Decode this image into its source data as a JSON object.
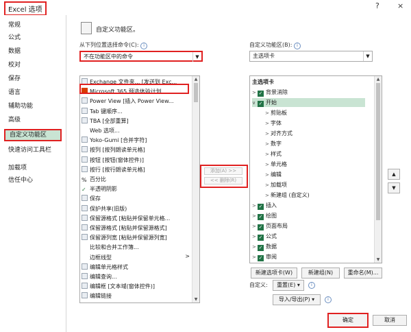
{
  "window": {
    "title": "Excel 选项",
    "help": "?",
    "close": "×"
  },
  "sidebar": {
    "items": [
      {
        "label": "常规"
      },
      {
        "label": "公式"
      },
      {
        "label": "数据"
      },
      {
        "label": "校对"
      },
      {
        "label": "保存"
      },
      {
        "label": "语言"
      },
      {
        "label": "辅助功能"
      },
      {
        "label": "高级"
      },
      {
        "label": "自定义功能区",
        "active": true
      },
      {
        "label": "快速访问工具栏"
      },
      {
        "label": "加载项"
      },
      {
        "label": "信任中心"
      }
    ]
  },
  "main": {
    "section_title": "自定义功能区。",
    "left": {
      "label": "从下列位置选择命令(C):",
      "info": "i",
      "dropdown_value": "不在功能区中的命令",
      "commands": [
        {
          "label": "Exchange 文件夹... [发送到 Exc...",
          "icon": "exchange-icon"
        },
        {
          "label": "Microsoft 365 预选体验计划",
          "icon": "office-icon",
          "highlight": true
        },
        {
          "label": "Power View [插入 Power View...",
          "icon": "powerview-icon"
        },
        {
          "label": "Tab 键顺序...",
          "icon": "tab-order-icon"
        },
        {
          "label": "TBA [全部重算]",
          "icon": "calc-icon"
        },
        {
          "label": "Web 选项...",
          "icon": "none"
        },
        {
          "label": "Yoko-Gumi [合并字符]",
          "icon": "dot-icon"
        },
        {
          "label": "按列 [按列朗读单元格]",
          "icon": "column-icon"
        },
        {
          "label": "按钮 [按钮(窗体控件)]",
          "icon": "button-icon"
        },
        {
          "label": "按行 [按行朗读单元格]",
          "icon": "row-icon"
        },
        {
          "label": "百分比",
          "icon": "percent-icon"
        },
        {
          "label": "半透明阴影",
          "icon": "check-icon"
        },
        {
          "label": "保存",
          "icon": "save-icon"
        },
        {
          "label": "保护共享(旧版)",
          "icon": "protect-icon"
        },
        {
          "label": "保留源格式 [粘贴并保留单元格...",
          "icon": "paste-icon"
        },
        {
          "label": "保留源格式 [粘贴并保留源格式]",
          "icon": "paste-icon"
        },
        {
          "label": "保留源列宽 [粘贴并保留源列宽]",
          "icon": "paste-icon"
        },
        {
          "label": "比较和合并工作簿...",
          "icon": "none"
        },
        {
          "label": "边框线型",
          "icon": "none",
          "submenu": true
        },
        {
          "label": "编辑单元格样式",
          "icon": "style-icon"
        },
        {
          "label": "编辑查询...",
          "icon": "query-icon"
        },
        {
          "label": "编辑框 [文本域(窗体控件)]",
          "icon": "textbox-icon"
        },
        {
          "label": "编辑链接",
          "icon": "link-icon"
        }
      ]
    },
    "middle": {
      "add": "添加(A) >>",
      "remove": "<< 删除(R)"
    },
    "right": {
      "label": "自定义功能区(B):",
      "info": "i",
      "dropdown_value": "主选项卡",
      "tree": [
        {
          "label": "主选项卡",
          "level": 0,
          "header": true
        },
        {
          "label": "背景消除",
          "level": 1,
          "expander": ">",
          "checked": true
        },
        {
          "label": "开始",
          "level": 1,
          "expander": "∨",
          "checked": true,
          "selected": true
        },
        {
          "label": "剪贴板",
          "level": 2,
          "expander": ">"
        },
        {
          "label": "字体",
          "level": 2,
          "expander": ">"
        },
        {
          "label": "对齐方式",
          "level": 2,
          "expander": ">"
        },
        {
          "label": "数字",
          "level": 2,
          "expander": ">"
        },
        {
          "label": "样式",
          "level": 2,
          "expander": ">"
        },
        {
          "label": "单元格",
          "level": 2,
          "expander": ">"
        },
        {
          "label": "编辑",
          "level": 2,
          "expander": ">"
        },
        {
          "label": "加载项",
          "level": 2,
          "expander": ">"
        },
        {
          "label": "新建组 (自定义)",
          "level": 2,
          "expander": ">"
        },
        {
          "label": "插入",
          "level": 1,
          "expander": ">",
          "checked": true
        },
        {
          "label": "绘图",
          "level": 1,
          "expander": ">",
          "checked": true
        },
        {
          "label": "页面布局",
          "level": 1,
          "expander": ">",
          "checked": true
        },
        {
          "label": "公式",
          "level": 1,
          "expander": ">",
          "checked": true
        },
        {
          "label": "数据",
          "level": 1,
          "expander": ">",
          "checked": true
        },
        {
          "label": "审阅",
          "level": 1,
          "expander": ">",
          "checked": true
        }
      ],
      "new_tab": "新建选项卡(W)",
      "new_group": "新建组(N)",
      "rename": "重命名(M)...",
      "customize_label": "自定义:",
      "reset": "重置(E) ▾",
      "import_export": "导入/导出(P) ▾"
    },
    "updown": {
      "up": "▲",
      "down": "▼"
    }
  },
  "footer": {
    "ok": "确定",
    "cancel": "取消"
  }
}
